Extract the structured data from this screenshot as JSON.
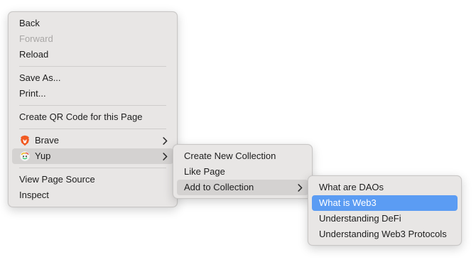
{
  "context_menu": {
    "items": {
      "back": "Back",
      "forward": "Forward",
      "reload": "Reload",
      "save_as": "Save As...",
      "print": "Print...",
      "create_qr": "Create QR Code for this Page",
      "brave": "Brave",
      "yup": "Yup",
      "view_source": "View Page Source",
      "inspect": "Inspect"
    }
  },
  "yup_submenu": {
    "items": {
      "create_collection": "Create New Collection",
      "like_page": "Like Page",
      "add_to_collection": "Add to Collection"
    }
  },
  "collection_submenu": {
    "items": [
      "What are DAOs",
      "What is Web3",
      "Understanding DeFi",
      "Understanding Web3 Protocols"
    ],
    "selected_index": 1
  },
  "icons": {
    "brave": "brave-lion-icon",
    "yup": "yup-icon",
    "submenu": "chevron-right-icon"
  },
  "colors": {
    "menu_background": "#e8e6e5",
    "hover_highlight": "#d4d2d1",
    "selection_blue": "#5b9cf3",
    "brave_orange": "#f15a22"
  }
}
